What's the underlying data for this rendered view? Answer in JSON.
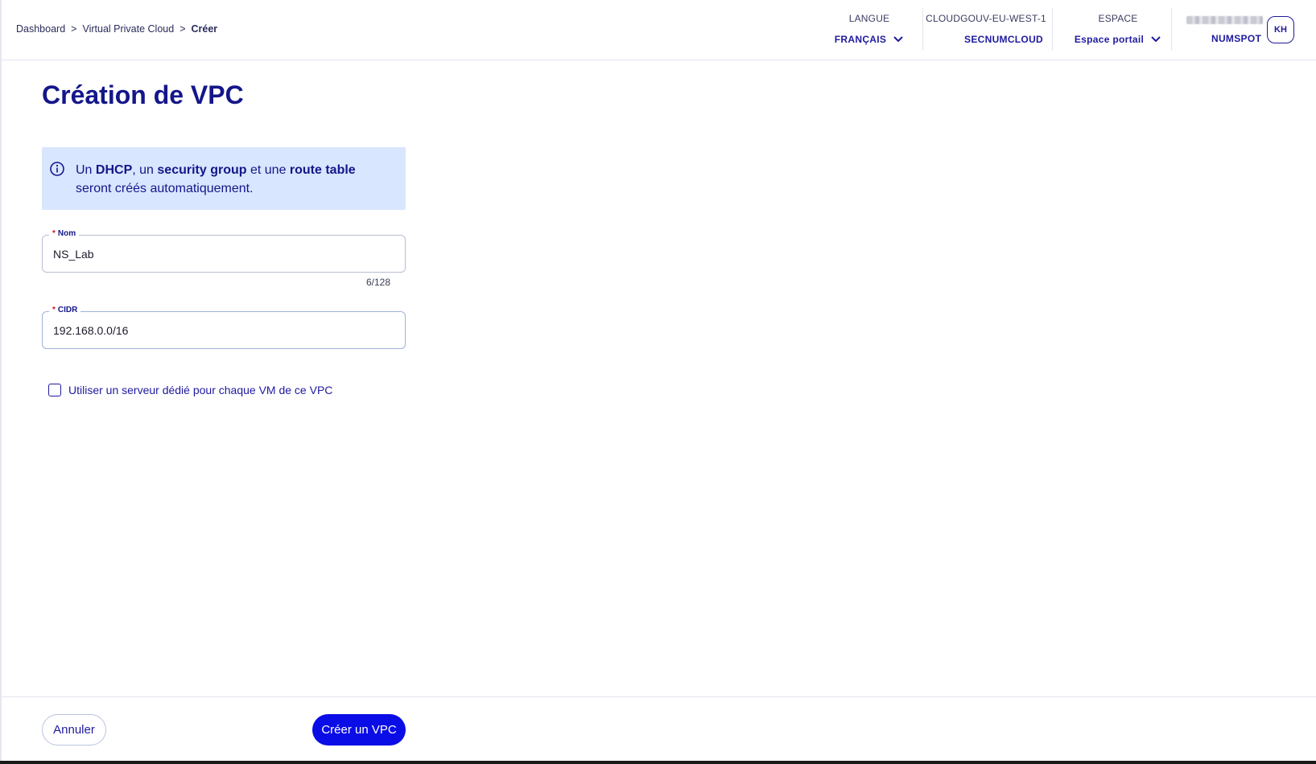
{
  "breadcrumb": {
    "items": [
      "Dashboard",
      "Virtual Private Cloud"
    ],
    "separator": ">",
    "current": "Créer"
  },
  "header": {
    "language": {
      "label": "LANGUE",
      "value": "FRANÇAIS"
    },
    "region": {
      "label": "CLOUDGOUV-EU-WEST-1",
      "value": "SECNUMCLOUD"
    },
    "space": {
      "label": "ESPACE",
      "value": "Espace portail"
    },
    "user": {
      "organization": "NUMSPOT",
      "initials": "KH"
    }
  },
  "page": {
    "title": "Création de VPC"
  },
  "info": {
    "t1": "Un ",
    "b1": "DHCP",
    "t2": ", un ",
    "b2": "security group",
    "t3": " et une ",
    "b3": "route table",
    "t4": " seront créés automatiquement."
  },
  "form": {
    "name": {
      "required_mark": "*",
      "label": "Nom",
      "value": "NS_Lab",
      "counter": "6/128"
    },
    "cidr": {
      "required_mark": "*",
      "label": "CIDR",
      "value": "192.168.0.0/16"
    },
    "dedicated": {
      "label": "Utiliser un serveur dédié pour chaque VM de ce VPC",
      "checked": false
    }
  },
  "footer": {
    "cancel_label": "Annuler",
    "submit_label": "Créer un VPC"
  },
  "colors": {
    "brand_navy": "#14168a",
    "primary_button": "#0a0de6",
    "info_background": "#d9e6ff",
    "required": "#d0141e"
  }
}
